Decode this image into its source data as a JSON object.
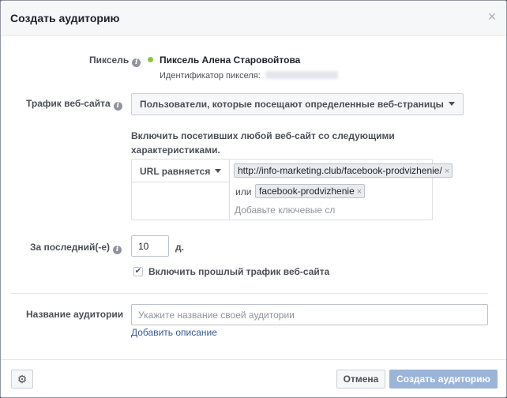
{
  "dialog": {
    "title": "Создать аудиторию",
    "close_glyph": "×"
  },
  "pixel": {
    "label": "Пиксель",
    "name": "Пиксель Алена Старовойтова",
    "id_label": "Идентификатор пикселя:",
    "status_color": "#8cc63f"
  },
  "traffic": {
    "label": "Трафик веб-сайта",
    "selected": "Пользователи, которые посещают определенные веб-страницы"
  },
  "include": {
    "text": "Включить посетивших любой веб-сайт со следующими характеристиками."
  },
  "rule": {
    "operator": "URL равняется",
    "value1": "http://info-marketing.club/facebook-prodvizhenie/",
    "or_label": "или",
    "value2": "facebook-prodvizhenie",
    "keyword_placeholder": "Добавьте ключевые сл"
  },
  "duration": {
    "label": "За последний(-е)",
    "value": "10",
    "unit": "д."
  },
  "past_traffic": {
    "label": "Включить прошлый трафик веб-сайта",
    "checked": true
  },
  "audience_name": {
    "label": "Название аудитории",
    "placeholder": "Укажите название своей аудитории",
    "add_description": "Добавить описание"
  },
  "footer": {
    "cancel_label": "Отмена",
    "create_label": "Создать аудиторию"
  },
  "icons": {
    "info": "info-icon",
    "gear": "gear-icon",
    "check": "✔",
    "remove": "×"
  },
  "colors": {
    "primary_disabled": "#9cb4d8",
    "link": "#365899"
  }
}
